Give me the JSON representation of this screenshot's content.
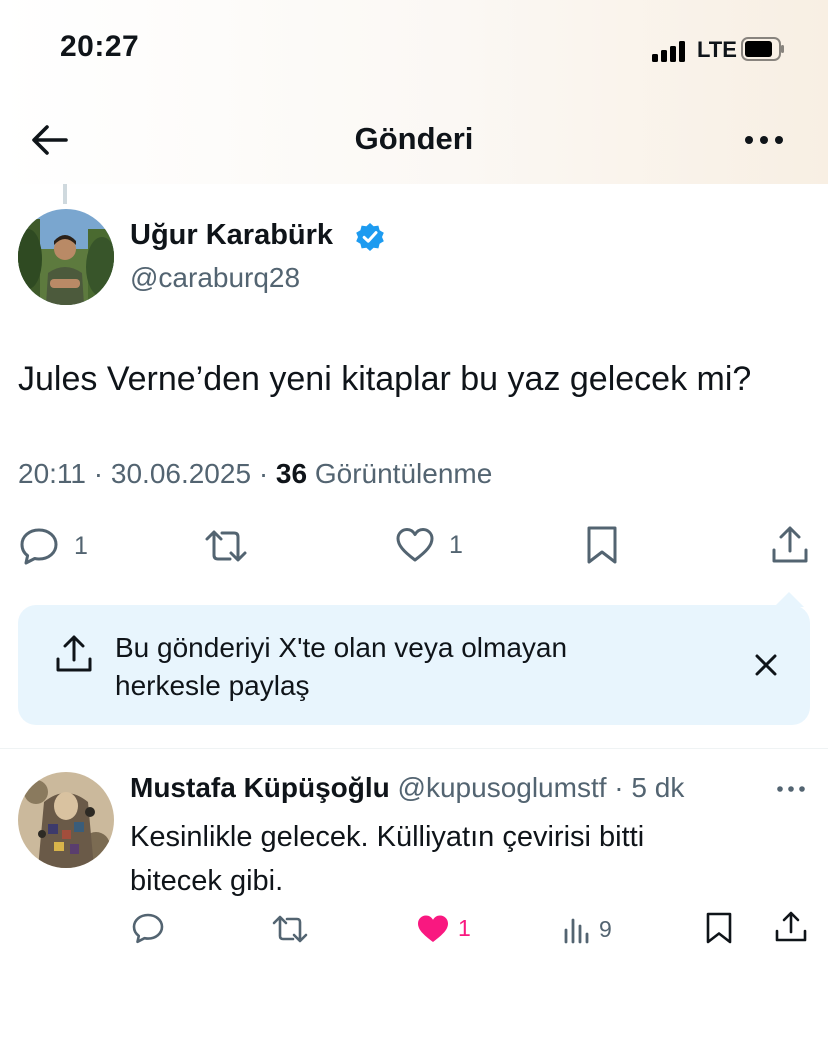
{
  "status_bar": {
    "time": "20:27",
    "network": "LTE"
  },
  "nav": {
    "title": "Gönderi",
    "back_icon": "arrow-left-icon",
    "more_icon": "more-horizontal-icon"
  },
  "tweet": {
    "author_name": "Uğur Karabürk",
    "handle": "@caraburq28",
    "verified": true,
    "text": "Jules Verne’den yeni kitaplar bu yaz gelecek mi?",
    "time": "20:11",
    "date": "30.06.2025",
    "sep": "·",
    "views_count": "36",
    "views_label": "Görüntülenme",
    "actions": {
      "reply_count": "1",
      "repost_count": "",
      "like_count": "1"
    }
  },
  "share_prompt": {
    "text_line1": "Bu gönderiyi X'te olan veya olmayan",
    "text_line2": "herkesle paylaş"
  },
  "reply": {
    "author_name": "Mustafa Küpüşoğlu",
    "handle": "@kupusoglumstf",
    "sep": "·",
    "time": "5 dk",
    "text_line1": "Kesinlikle gelecek. Külliyatın çevirisi bitti",
    "text_line2": "bitecek gibi.",
    "actions": {
      "like_count": "1",
      "views_count": "9"
    }
  },
  "colors": {
    "accent": "#1d9bf0",
    "like": "#f91880",
    "muted": "#536471",
    "share_bg": "#e8f5fd"
  }
}
